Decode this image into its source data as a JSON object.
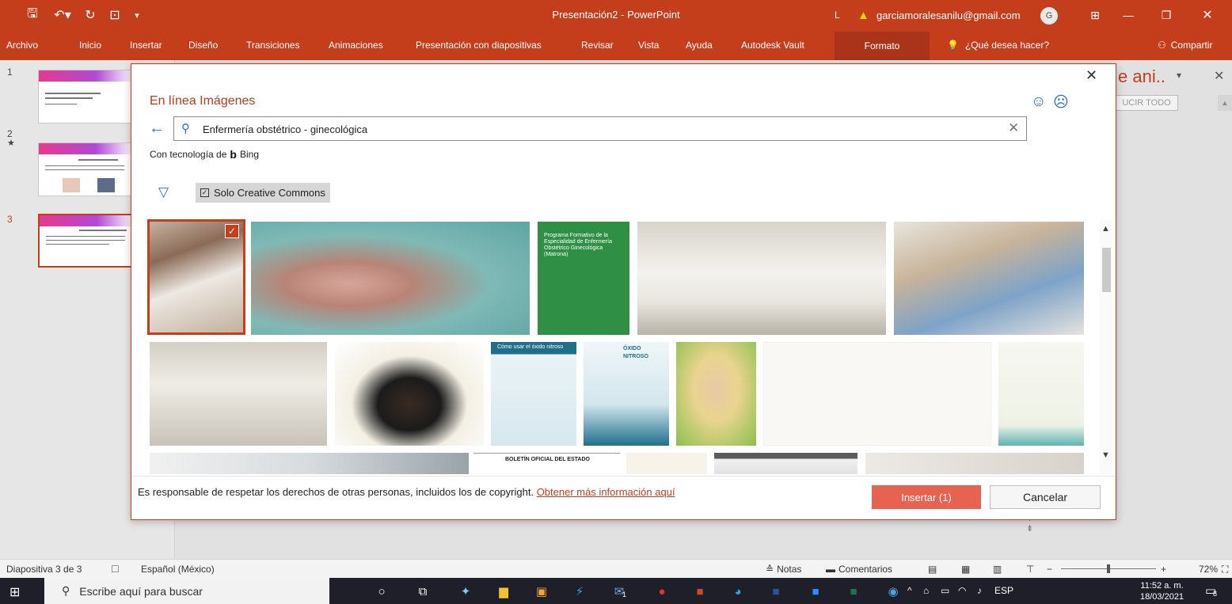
{
  "titlebar": {
    "title": "Presentación2 - PowerPoint",
    "account": "garciamoralesanilu@gmail.com",
    "avatar_initial": "G",
    "account_prefix": "L"
  },
  "ribbon": {
    "tabs": [
      "Archivo",
      "Inicio",
      "Insertar",
      "Diseño",
      "Transiciones",
      "Animaciones",
      "Presentación con diapositivas",
      "Revisar",
      "Vista",
      "Ayuda",
      "Autodesk Vault"
    ],
    "context_tab": "Formato",
    "tell_me": "¿Qué desea hacer?",
    "share": "Compartir"
  },
  "slides": {
    "numbers": [
      "1",
      "2",
      "3"
    ],
    "star": "★"
  },
  "animation_pane": {
    "title": "e ani..",
    "button": "UCIR TODO"
  },
  "dialog": {
    "title": "En línea Imágenes",
    "search_value": "Enfermería obstétrico - ginecológica",
    "powered_by": "Con tecnología de",
    "bing": "Bing",
    "filter_label": "Solo Creative Commons",
    "thumbnail_text": {
      "book_title": "Programa Formativo de la Especialidad de Enfermería Obstétrico Ginecológica (Matrona)",
      "infographic_title": "Cómo usar el óxido nitroso",
      "infographic2_title": "ÓXIDO NITROSO",
      "boe": "BOLETÍN OFICIAL DEL ESTADO"
    },
    "notice": "Es responsable de respetar los derechos de otras personas, incluidos los de copyright.",
    "notice_link": "Obtener más información aquí",
    "insert_button": "Insertar (1)",
    "cancel_button": "Cancelar"
  },
  "statusbar": {
    "slide_info": "Diapositiva 3 de 3",
    "language": "Español (México)",
    "notes": "Notas",
    "comments": "Comentarios",
    "zoom": "72%"
  },
  "taskbar": {
    "search_placeholder": "Escribe aquí para buscar",
    "mail_badge": "1",
    "language": "ESP",
    "time": "11:52 a. m.",
    "date": "18/03/2021",
    "notification_count": "8"
  },
  "colors": {
    "accent": "#c43e1c",
    "insert_button": "#e8634f",
    "link": "#2f6fbf"
  }
}
